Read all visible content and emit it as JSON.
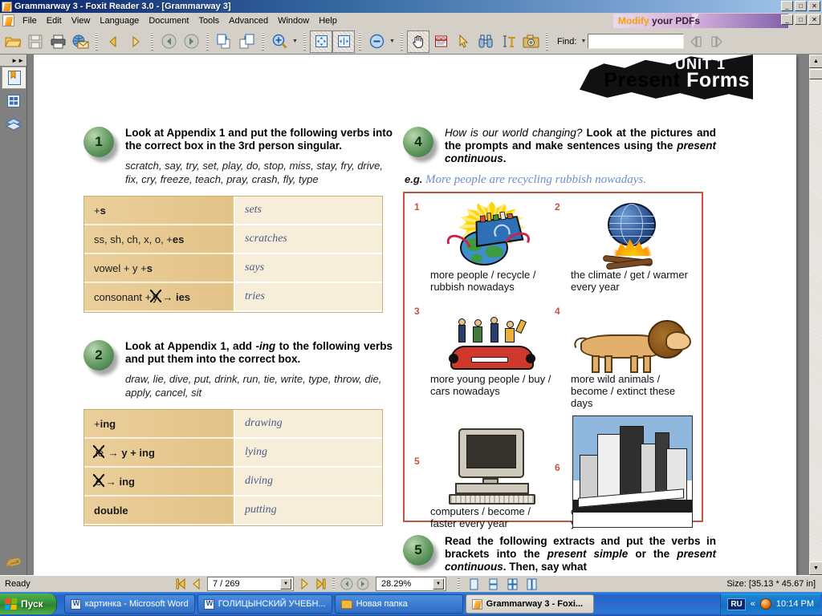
{
  "window": {
    "title": "Grammarway 3 - Foxit Reader 3.0 - [Grammarway 3]",
    "minimize": "_",
    "maximize": "□",
    "close": "✕",
    "app_icon": "foxit-logo-icon"
  },
  "menu": {
    "items": [
      "File",
      "Edit",
      "View",
      "Language",
      "Document",
      "Tools",
      "Advanced",
      "Window",
      "Help"
    ],
    "banner": {
      "text_accent": "Modify",
      "text_rest": "your PDFs",
      "accent_color": "#f5a300"
    }
  },
  "toolbar": {
    "find_label": "Find:",
    "find_value": "",
    "find_placeholder": "",
    "buttons": [
      "open-icon",
      "save-icon",
      "print-icon",
      "email-icon",
      "previous-view-icon",
      "next-view-icon",
      "back-icon",
      "forward-icon",
      "insert-pages-icon",
      "extract-pages-icon",
      "zoom-in-tool-icon",
      "zoom-dropdown-caret",
      "fit-page-icon",
      "fit-width-icon",
      "zoom-out-icon",
      "zoom-out-caret",
      "hand-tool-icon",
      "text-viewer-icon",
      "select-tool-icon",
      "find-binoculars-icon",
      "text-select-icon",
      "snapshot-icon",
      "find-dropdown-caret",
      "find-previous-icon",
      "find-next-icon"
    ]
  },
  "navpane": {
    "collapse_label": "►►",
    "tabs": [
      "bookmarks-icon",
      "pages-icon",
      "layers-icon"
    ],
    "bottom": "attachments-paperclip-icon"
  },
  "document": {
    "unit_label": "UNIT 1",
    "unit_title_part1": "Present",
    "unit_title_part2": "Forms",
    "exercises": [
      {
        "number": "1",
        "heading": "Look at Appendix 1 and put the following verbs into the correct box in the 3rd person singular.",
        "verbs": "scratch, say, try, set, play, do, stop, miss, stay, fry, drive, fix, cry, freeze, teach, pray, crash, fly, type",
        "table": [
          {
            "rule_pre": "+",
            "rule_bold": "s",
            "rule_post": "",
            "example": "sets"
          },
          {
            "rule_pre": "ss, sh, ch, x, o, + ",
            "rule_bold": "es",
            "rule_post": "",
            "example": "scratches"
          },
          {
            "rule_pre": "vowel + y + ",
            "rule_bold": "s",
            "rule_post": "",
            "example": "says"
          },
          {
            "rule_pre": "consonant + ",
            "rule_strike": "y",
            "rule_arrow": "→",
            "rule_bold": "ies",
            "example": "tries"
          }
        ]
      },
      {
        "number": "2",
        "heading_a": "Look at Appendix 1, add ",
        "heading_i": "-ing",
        "heading_b": " to the following verbs and put them into the correct box.",
        "verbs": "draw, lie, die, put, drink, run, tie, write, type, throw, die, apply, cancel, sit",
        "verbs_display": "draw, lie, dive, put, drink, run, tie, write, type, throw, die, apply, cancel, sit",
        "table": [
          {
            "rule_pre": "+ ",
            "rule_bold": "ing",
            "example": "drawing"
          },
          {
            "rule_strike": "ie",
            "rule_arrow": "→",
            "rule_bold": "y + ing",
            "example": "lying"
          },
          {
            "rule_strike": "e",
            "rule_arrow": "→",
            "rule_bold": "ing",
            "example": "diving"
          },
          {
            "rule_bold": "double",
            "example": "putting"
          }
        ]
      },
      {
        "number": "4",
        "heading_i": "How is our world changing?",
        "heading_b": " Look at the pictures and the prompts and make sentences using the ",
        "heading_i2": "present continuous",
        "heading_end": ".",
        "eg_label": "e.g.",
        "eg_text": "More people are recycling rubbish nowadays.",
        "pictures": [
          {
            "num": "1",
            "caption": "more people / recycle / rubbish nowadays",
            "art": "recycling-globe-art"
          },
          {
            "num": "2",
            "caption": "the climate / get / warmer every year",
            "art": "globe-fire-art"
          },
          {
            "num": "3",
            "caption": "more young people / buy / cars nowadays",
            "art": "red-car-people-art"
          },
          {
            "num": "4",
            "caption": "more wild animals / become / extinct these days",
            "art": "lion-art"
          },
          {
            "num": "5",
            "caption": "computers / become / faster every year",
            "art": "desktop-computer-art"
          },
          {
            "num": "6",
            "caption": "cities / grow / bigger every year",
            "art": "city-buildings-art"
          }
        ]
      },
      {
        "number": "5",
        "heading_a": "Read the following extracts and put the verbs in brackets into the ",
        "heading_i": "present simple",
        "heading_b": " or the ",
        "heading_i2": "present continuous",
        "heading_end": ". Then, say what"
      }
    ]
  },
  "statusbar": {
    "ready": "Ready",
    "first_page": "first-page-icon",
    "prev_page": "previous-page-icon",
    "page_value": "7 / 269",
    "next_page": "next-page-icon",
    "last_page": "last-page-icon",
    "back": "back-icon",
    "forward": "forward-icon",
    "zoom_value": "28.29%",
    "views": [
      "single-page-view-icon",
      "continuous-view-icon",
      "facing-view-icon",
      "continuous-facing-view-icon"
    ],
    "size": "Size: [35.13 * 45.67 in]"
  },
  "taskbar": {
    "start_label": "Пуск",
    "items": [
      {
        "label": "картинка - Microsoft Word",
        "icon": "word-icon",
        "active": false
      },
      {
        "label": "ГОЛИЦЫНСКИЙ УЧЕБН...",
        "icon": "word-icon",
        "active": false
      },
      {
        "label": "Новая папка",
        "icon": "folder-icon",
        "active": false
      },
      {
        "label": "Grammarway 3 - Foxi...",
        "icon": "foxit-icon",
        "active": true
      }
    ],
    "tray": {
      "language": "RU",
      "chevron": "«",
      "icon": "tray-app-icon",
      "clock": "10:14 PM"
    }
  },
  "colors": {
    "accent_blue": "#0a246a",
    "chrome": "#d4d0c8",
    "picbox_border": "#c4533f",
    "table_left": "#e8c98f",
    "table_right": "#f6eed9",
    "handwriting": "#6d8ec9"
  }
}
